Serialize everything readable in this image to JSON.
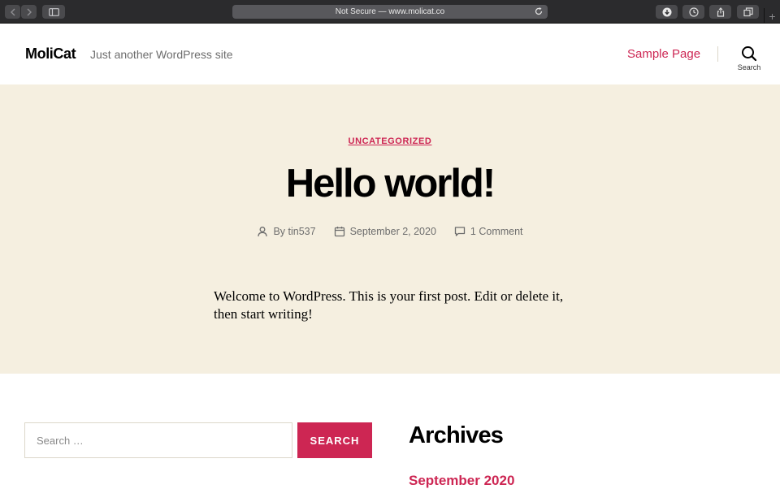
{
  "browser": {
    "url_text": "Not Secure — www.molicat.co",
    "new_tab_glyph": "+",
    "icons": [
      "back-icon",
      "forward-icon",
      "sidebar-icon",
      "reload-icon",
      "download-icon",
      "history-icon",
      "share-icon",
      "tabs-icon"
    ]
  },
  "header": {
    "site_title": "MoliCat",
    "site_description": "Just another WordPress site",
    "nav": [
      {
        "label": "Sample Page"
      }
    ],
    "search_label": "Search"
  },
  "post": {
    "category": "UNCATEGORIZED",
    "title": "Hello world!",
    "author": "By tin537",
    "date": "September 2, 2020",
    "comments": "1 Comment",
    "content": "Welcome to WordPress. This is your first post. Edit or delete it, then start writing!"
  },
  "widgets": {
    "search": {
      "placeholder": "Search …",
      "button_label": "SEARCH"
    },
    "archives": {
      "title": "Archives",
      "items": [
        {
          "label": "September 2020"
        }
      ]
    }
  },
  "colors": {
    "accent": "#cd2653",
    "hero_bg": "#f5efe0",
    "chrome_bg": "#2b2b2d"
  }
}
